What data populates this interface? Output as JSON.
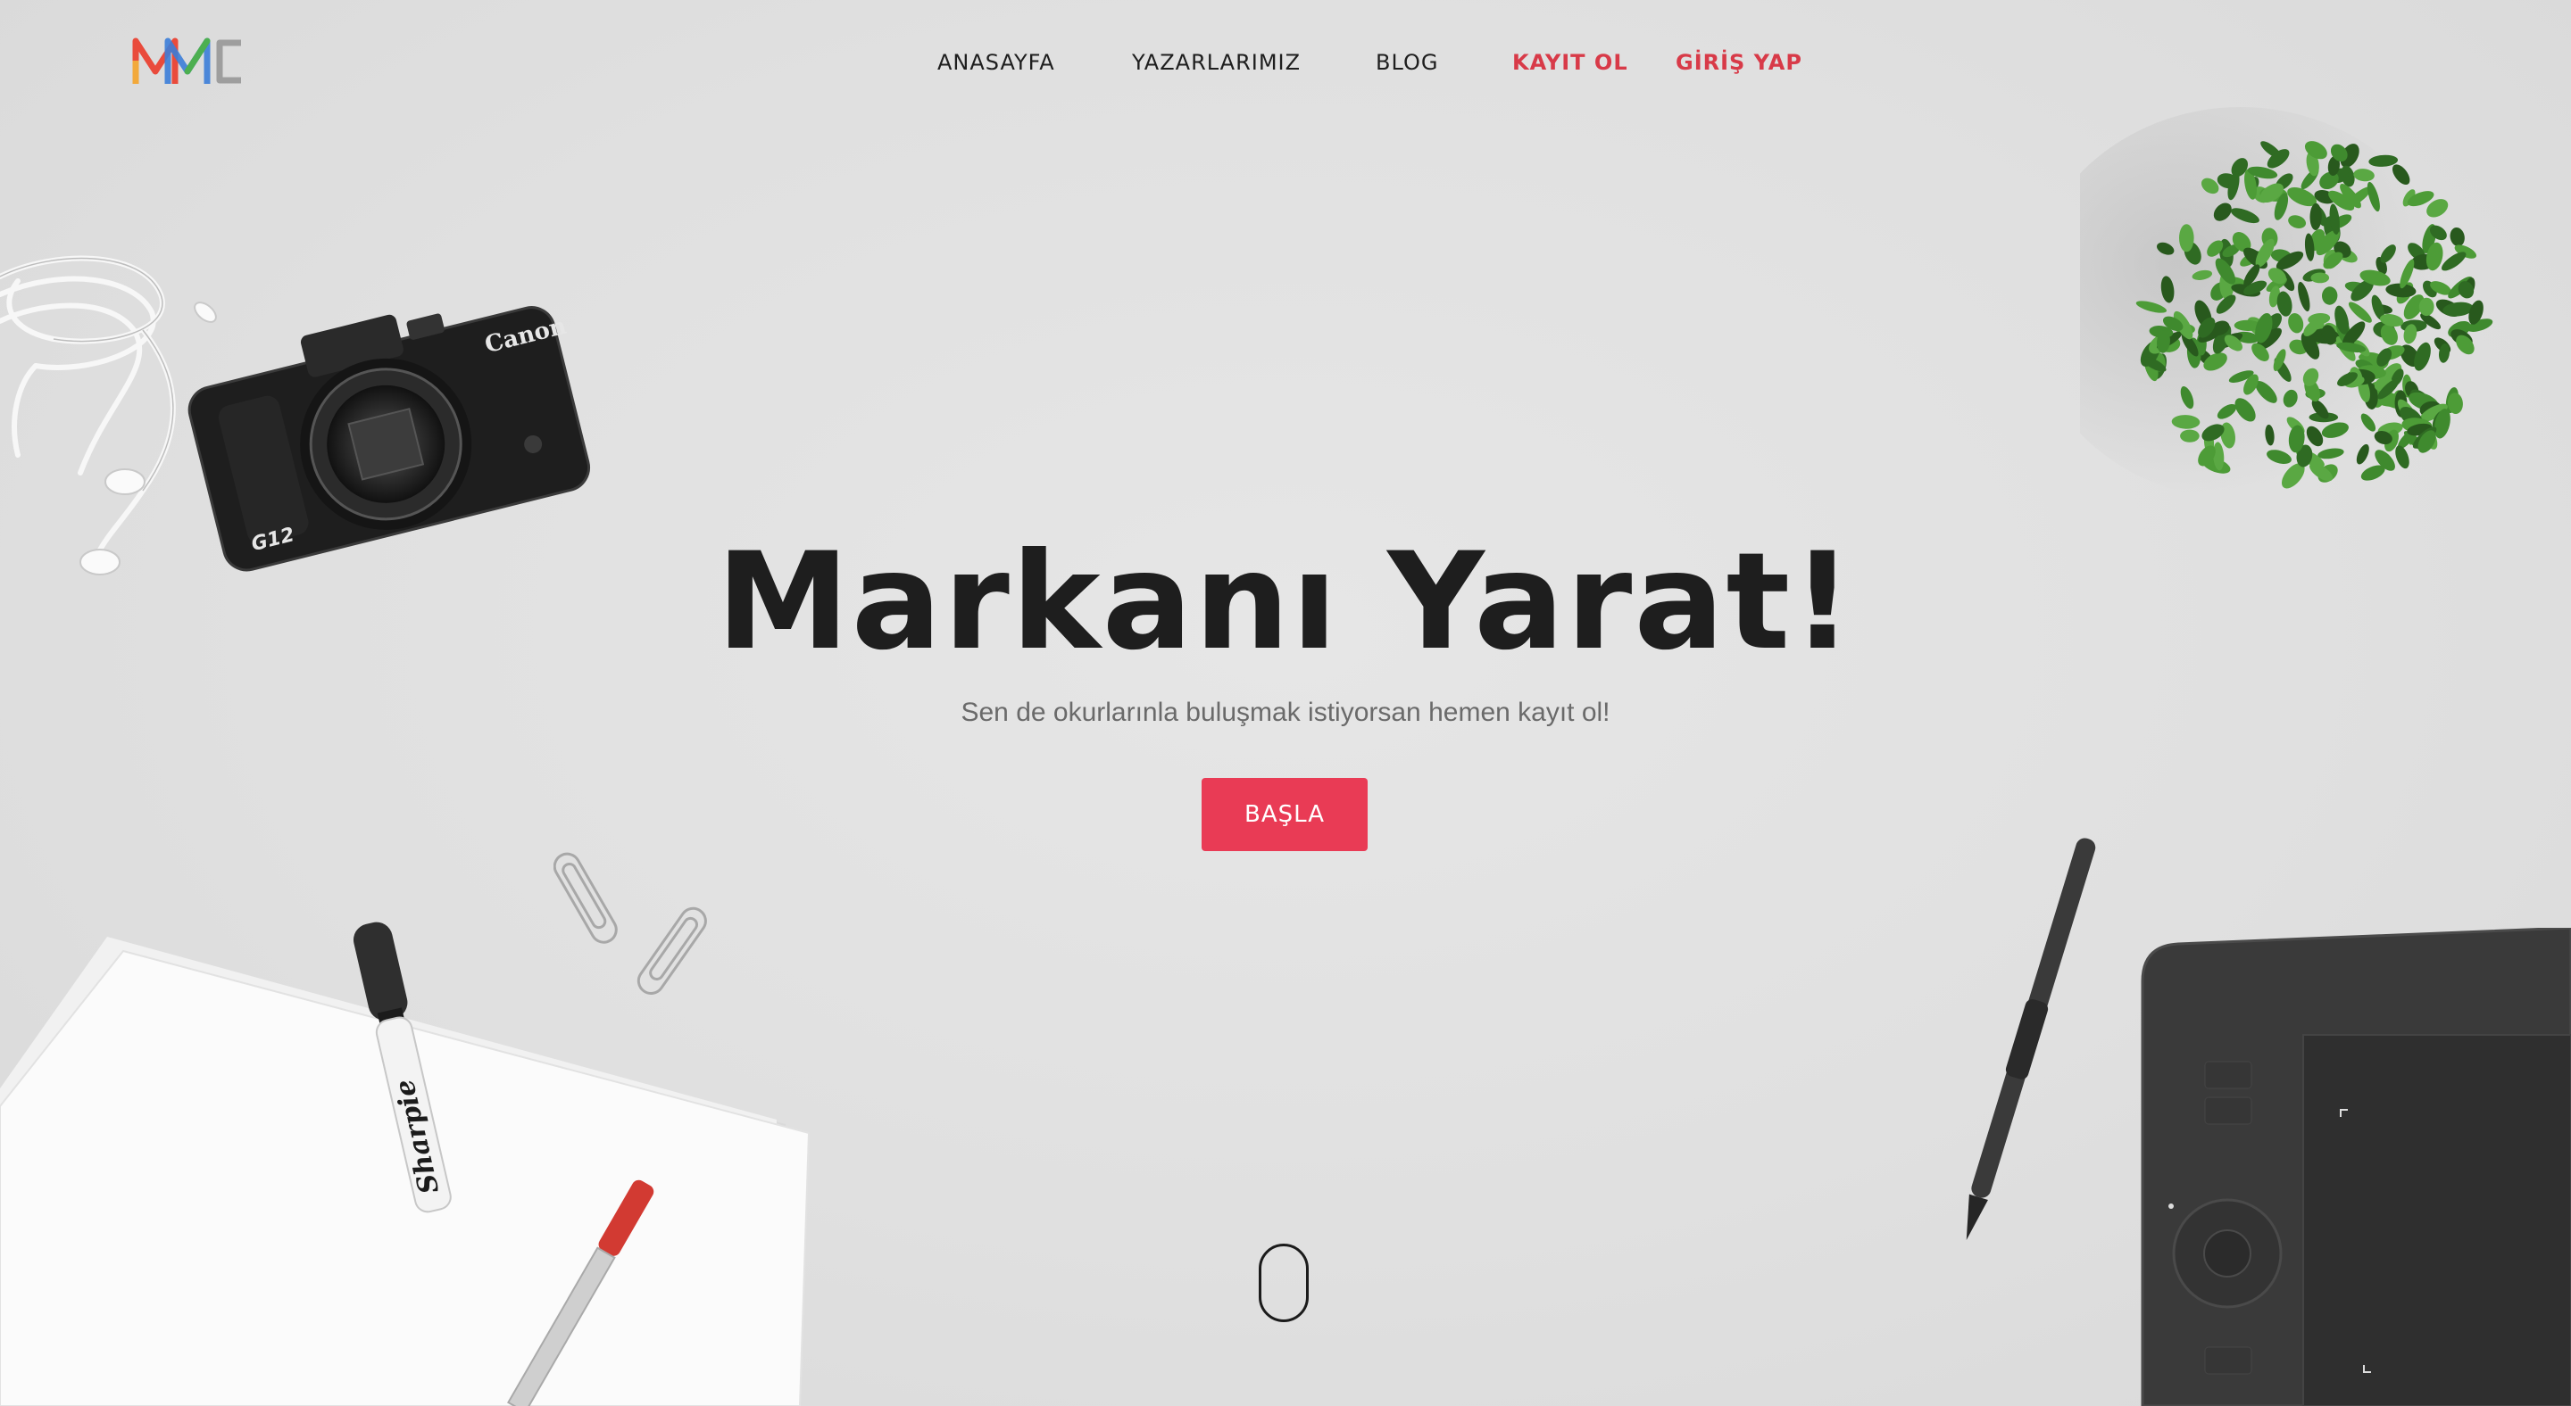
{
  "logo": {
    "alt": "MMC",
    "colors": [
      "#e94b3c",
      "#f2a93b",
      "#3b7dd8",
      "#4caf50",
      "#9e9e9e"
    ]
  },
  "nav": {
    "items": [
      {
        "label": "ANASAYFA",
        "accent": false
      },
      {
        "label": "YAZARLARIMIZ",
        "accent": false
      },
      {
        "label": "BLOG",
        "accent": false
      },
      {
        "label": "KAYIT OL",
        "accent": true
      },
      {
        "label": "GİRİŞ YAP",
        "accent": true
      }
    ]
  },
  "hero": {
    "title": "Markanı Yarat!",
    "subtitle": "Sen de okurlarınla buluşmak istiyorsan hemen kayıt ol!",
    "cta_label": "BAŞLA"
  },
  "decor": {
    "camera_brand": "Canon",
    "camera_model": "G12",
    "marker_brand": "Sharpie"
  },
  "colors": {
    "accent": "#d83a48",
    "button": "#e93b55",
    "text": "#1e1e1e",
    "muted": "#6a6a6a",
    "background": "#e0e0e0"
  },
  "icons": [
    "logo-mark",
    "scroll-mouse-icon"
  ]
}
